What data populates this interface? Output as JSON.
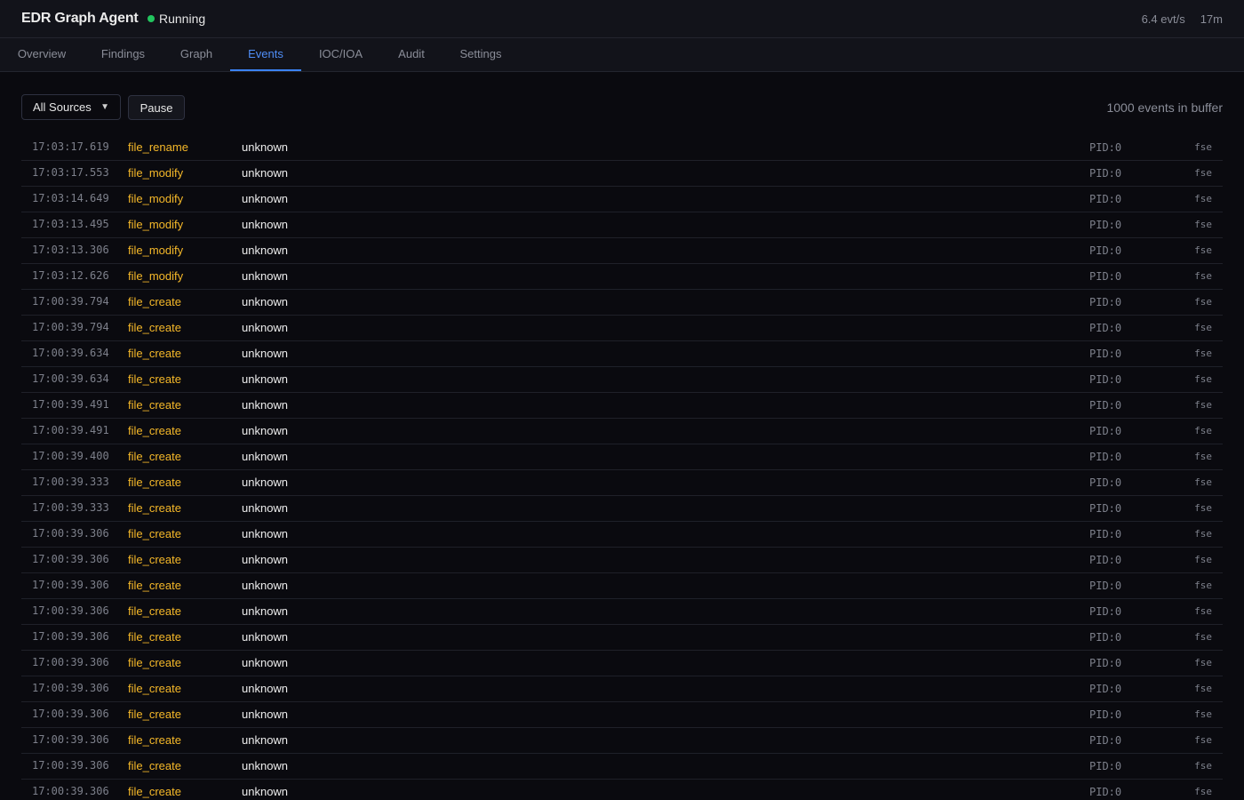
{
  "header": {
    "title": "EDR Graph Agent",
    "status": "Running",
    "status_color": "#22c55e",
    "rate": "6.4 evt/s",
    "uptime": "17m"
  },
  "tabs": [
    {
      "label": "Overview"
    },
    {
      "label": "Findings"
    },
    {
      "label": "Graph"
    },
    {
      "label": "Events",
      "active": true
    },
    {
      "label": "IOC/IOA"
    },
    {
      "label": "Audit"
    },
    {
      "label": "Settings"
    }
  ],
  "toolbar": {
    "source_selected": "All Sources",
    "pause_label": "Pause",
    "buffer_text": "1000 events in buffer"
  },
  "events": [
    {
      "time": "17:03:17.619",
      "type": "file_rename",
      "process": "unknown",
      "pid": "PID:0",
      "source": "fse"
    },
    {
      "time": "17:03:17.553",
      "type": "file_modify",
      "process": "unknown",
      "pid": "PID:0",
      "source": "fse"
    },
    {
      "time": "17:03:14.649",
      "type": "file_modify",
      "process": "unknown",
      "pid": "PID:0",
      "source": "fse"
    },
    {
      "time": "17:03:13.495",
      "type": "file_modify",
      "process": "unknown",
      "pid": "PID:0",
      "source": "fse"
    },
    {
      "time": "17:03:13.306",
      "type": "file_modify",
      "process": "unknown",
      "pid": "PID:0",
      "source": "fse"
    },
    {
      "time": "17:03:12.626",
      "type": "file_modify",
      "process": "unknown",
      "pid": "PID:0",
      "source": "fse"
    },
    {
      "time": "17:00:39.794",
      "type": "file_create",
      "process": "unknown",
      "pid": "PID:0",
      "source": "fse"
    },
    {
      "time": "17:00:39.794",
      "type": "file_create",
      "process": "unknown",
      "pid": "PID:0",
      "source": "fse"
    },
    {
      "time": "17:00:39.634",
      "type": "file_create",
      "process": "unknown",
      "pid": "PID:0",
      "source": "fse"
    },
    {
      "time": "17:00:39.634",
      "type": "file_create",
      "process": "unknown",
      "pid": "PID:0",
      "source": "fse"
    },
    {
      "time": "17:00:39.491",
      "type": "file_create",
      "process": "unknown",
      "pid": "PID:0",
      "source": "fse"
    },
    {
      "time": "17:00:39.491",
      "type": "file_create",
      "process": "unknown",
      "pid": "PID:0",
      "source": "fse"
    },
    {
      "time": "17:00:39.400",
      "type": "file_create",
      "process": "unknown",
      "pid": "PID:0",
      "source": "fse"
    },
    {
      "time": "17:00:39.333",
      "type": "file_create",
      "process": "unknown",
      "pid": "PID:0",
      "source": "fse"
    },
    {
      "time": "17:00:39.333",
      "type": "file_create",
      "process": "unknown",
      "pid": "PID:0",
      "source": "fse"
    },
    {
      "time": "17:00:39.306",
      "type": "file_create",
      "process": "unknown",
      "pid": "PID:0",
      "source": "fse"
    },
    {
      "time": "17:00:39.306",
      "type": "file_create",
      "process": "unknown",
      "pid": "PID:0",
      "source": "fse"
    },
    {
      "time": "17:00:39.306",
      "type": "file_create",
      "process": "unknown",
      "pid": "PID:0",
      "source": "fse"
    },
    {
      "time": "17:00:39.306",
      "type": "file_create",
      "process": "unknown",
      "pid": "PID:0",
      "source": "fse"
    },
    {
      "time": "17:00:39.306",
      "type": "file_create",
      "process": "unknown",
      "pid": "PID:0",
      "source": "fse"
    },
    {
      "time": "17:00:39.306",
      "type": "file_create",
      "process": "unknown",
      "pid": "PID:0",
      "source": "fse"
    },
    {
      "time": "17:00:39.306",
      "type": "file_create",
      "process": "unknown",
      "pid": "PID:0",
      "source": "fse"
    },
    {
      "time": "17:00:39.306",
      "type": "file_create",
      "process": "unknown",
      "pid": "PID:0",
      "source": "fse"
    },
    {
      "time": "17:00:39.306",
      "type": "file_create",
      "process": "unknown",
      "pid": "PID:0",
      "source": "fse"
    },
    {
      "time": "17:00:39.306",
      "type": "file_create",
      "process": "unknown",
      "pid": "PID:0",
      "source": "fse"
    },
    {
      "time": "17:00:39.306",
      "type": "file_create",
      "process": "unknown",
      "pid": "PID:0",
      "source": "fse"
    }
  ]
}
